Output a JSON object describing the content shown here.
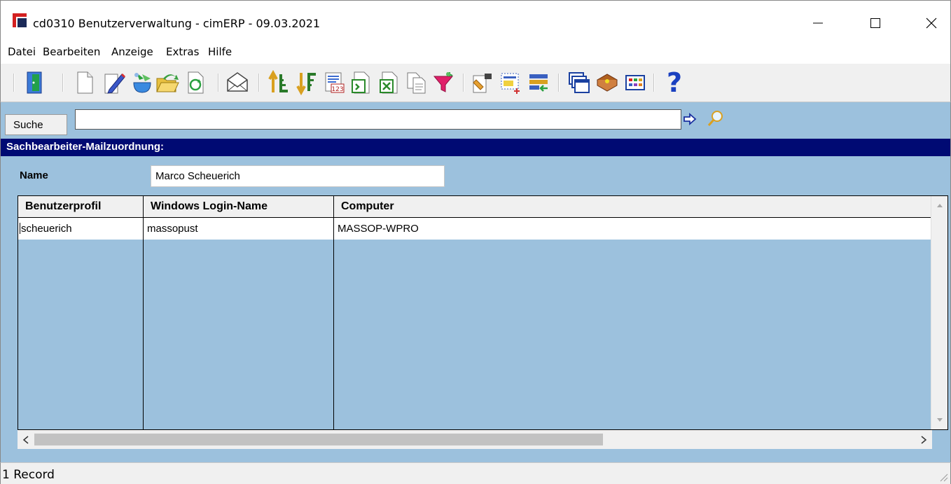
{
  "window": {
    "title": "cd0310 Benutzerverwaltung - cimERP - 09.03.2021",
    "minimize_glyph": "—",
    "maximize_glyph": "☐",
    "close_glyph": "✕"
  },
  "menu": {
    "items": [
      "Datei",
      "Bearbeiten",
      "Anzeige",
      "Extras",
      "Hilfe"
    ]
  },
  "toolbar": {
    "icons": [
      "exit-icon",
      "new-document-icon",
      "edit-icon",
      "save-icon",
      "open-folder-icon",
      "refresh-icon",
      "mail-icon",
      "sort-ascending-icon",
      "sort-descending-icon",
      "numbering-icon",
      "export-icon",
      "excel-export-icon",
      "copy-icon",
      "filter-icon",
      "properties-icon",
      "add-record-icon",
      "transfer-icon",
      "windows-icon",
      "book-icon",
      "table-view-icon",
      "help-icon"
    ]
  },
  "search": {
    "label": "Suche",
    "value": "",
    "placeholder": ""
  },
  "section": {
    "title": "Sachbearbeiter-Mailzuordnung:"
  },
  "form": {
    "name_label": "Name",
    "name_value": "Marco Scheuerich"
  },
  "grid": {
    "columns": [
      "Benutzerprofil",
      "Windows Login-Name",
      "Computer"
    ],
    "rows": [
      [
        "scheuerich",
        "massopust",
        "MASSOP-WPRO"
      ]
    ]
  },
  "status": {
    "text": "1 Record"
  },
  "colors": {
    "body_blue": "#9cc1dd",
    "header_navy": "#000a73",
    "brand_red": "#d32020"
  }
}
